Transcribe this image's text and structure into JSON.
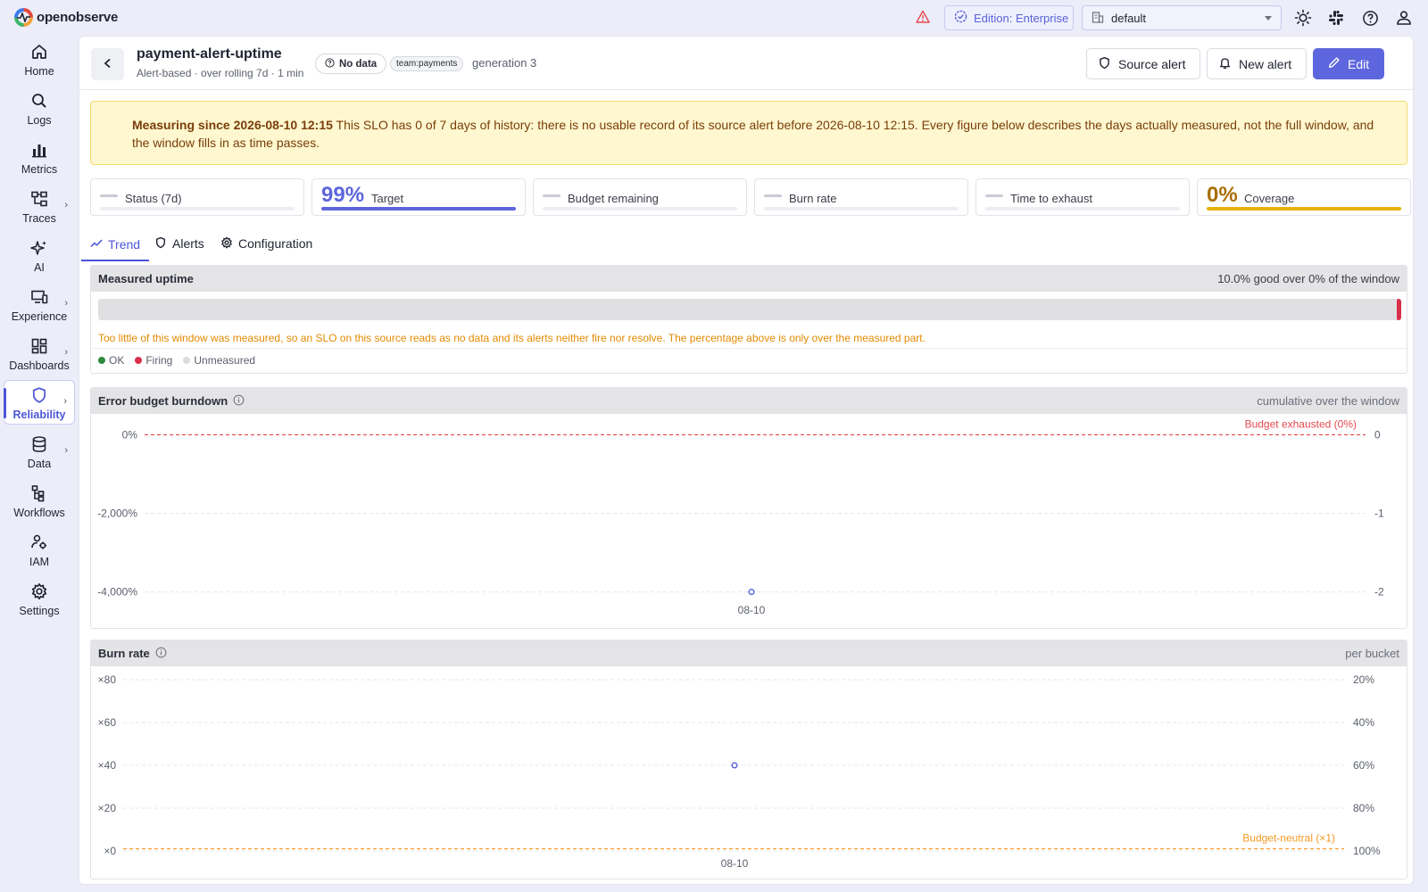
{
  "app": {
    "name": "openobserve"
  },
  "topbar": {
    "edition_label": "Edition: Enterprise",
    "org_value": "default",
    "icons": [
      "alert-triangle-icon",
      "sun-icon",
      "slack-icon",
      "help-icon",
      "user-icon"
    ]
  },
  "sidebar": {
    "items": [
      {
        "label": "Home",
        "icon": "home-icon",
        "chevron": false,
        "active": false
      },
      {
        "label": "Logs",
        "icon": "search-icon",
        "chevron": false,
        "active": false
      },
      {
        "label": "Metrics",
        "icon": "bar-chart-icon",
        "chevron": false,
        "active": false
      },
      {
        "label": "Traces",
        "icon": "traces-icon",
        "chevron": true,
        "active": false
      },
      {
        "label": "AI",
        "icon": "sparkle-icon",
        "chevron": false,
        "active": false
      },
      {
        "label": "Experience",
        "icon": "devices-icon",
        "chevron": true,
        "active": false
      },
      {
        "label": "Dashboards",
        "icon": "dashboard-icon",
        "chevron": true,
        "active": false
      },
      {
        "label": "Reliability",
        "icon": "shield-icon",
        "chevron": true,
        "active": true
      },
      {
        "label": "Data",
        "icon": "database-icon",
        "chevron": true,
        "active": false
      },
      {
        "label": "Workflows",
        "icon": "workflow-icon",
        "chevron": false,
        "active": false
      },
      {
        "label": "IAM",
        "icon": "users-gear-icon",
        "chevron": false,
        "active": false
      },
      {
        "label": "Settings",
        "icon": "gear-icon",
        "chevron": false,
        "active": false
      }
    ],
    "chevron_glyph": "›"
  },
  "header": {
    "title": "payment-alert-uptime",
    "subtitle": "Alert-based · over rolling 7d · 1 min",
    "status_badge": "No data",
    "team_badge": "team:payments",
    "generation": "generation 3",
    "buttons": {
      "source_alert": "Source alert",
      "new_alert": "New alert",
      "edit": "Edit"
    }
  },
  "banner": {
    "strong": "Measuring since 2026-08-10 12:15",
    "text": " This SLO has 0 of 7 days of history: there is no usable record of its source alert before 2026-08-10 12:15. Every figure below describes the days actually measured, not the full window, and the window fills in as time passes."
  },
  "stats": [
    {
      "label": "Status (7d)",
      "value": "",
      "bar": "none"
    },
    {
      "label": "Target",
      "value": "99%",
      "bar": "blue",
      "color": "#5d66dc"
    },
    {
      "label": "Budget remaining",
      "value": "",
      "bar": "none"
    },
    {
      "label": "Burn rate",
      "value": "",
      "bar": "none"
    },
    {
      "label": "Time to exhaust",
      "value": "",
      "bar": "none"
    },
    {
      "label": "Coverage",
      "value": "0%",
      "bar": "amber",
      "color": "#a86d00"
    }
  ],
  "tabs": [
    {
      "label": "Trend",
      "icon": "trend-icon",
      "active": true
    },
    {
      "label": "Alerts",
      "icon": "shield-icon",
      "active": false
    },
    {
      "label": "Configuration",
      "icon": "gear-icon",
      "active": false
    }
  ],
  "uptime": {
    "title": "Measured uptime",
    "summary": "10.0% good over 0% of the window",
    "note": "Too little of this window was measured, so an SLO on this source reads as no data and its alerts neither fire nor resolve. The percentage above is only over the measured part.",
    "legend": [
      {
        "label": "OK",
        "color": "#2e8b3e"
      },
      {
        "label": "Firing",
        "color": "#d9304a"
      },
      {
        "label": "Unmeasured",
        "color": "#dcdcde"
      }
    ]
  },
  "colors": {
    "accent": "#5d66dc",
    "danger": "#e5484d",
    "warning": "#f59a23",
    "firing": "#d9304a"
  },
  "chart_data": [
    {
      "type": "scatter",
      "title": "Error budget burndown",
      "note": "cumulative over the window",
      "x": [
        "08-10"
      ],
      "series": [
        {
          "values": [
            -4000
          ]
        }
      ],
      "y_left_ticks": [
        "0%",
        "-2,000%",
        "-4,000%"
      ],
      "y_left_values": [
        0,
        -2000,
        -4000
      ],
      "y_right_ticks": [
        "0",
        "-1",
        "-2"
      ],
      "ylim": [
        -4100,
        100
      ],
      "threshold": {
        "label": "Budget exhausted (0%)",
        "value": 0,
        "color": "#e5484d"
      },
      "grid": true
    },
    {
      "type": "scatter",
      "title": "Burn rate",
      "note": "per bucket",
      "x": [
        "08-10"
      ],
      "series": [
        {
          "values": [
            40
          ]
        }
      ],
      "y_left_ticks": [
        "×80",
        "×60",
        "×40",
        "×20",
        "×0"
      ],
      "y_left_values": [
        80,
        60,
        40,
        20,
        0
      ],
      "y_right_ticks": [
        "20%",
        "40%",
        "60%",
        "80%",
        "100%"
      ],
      "ylim": [
        0,
        80
      ],
      "threshold": {
        "label": "Budget-neutral (×1)",
        "value": 1,
        "color": "#f59a23"
      },
      "grid": true
    }
  ]
}
